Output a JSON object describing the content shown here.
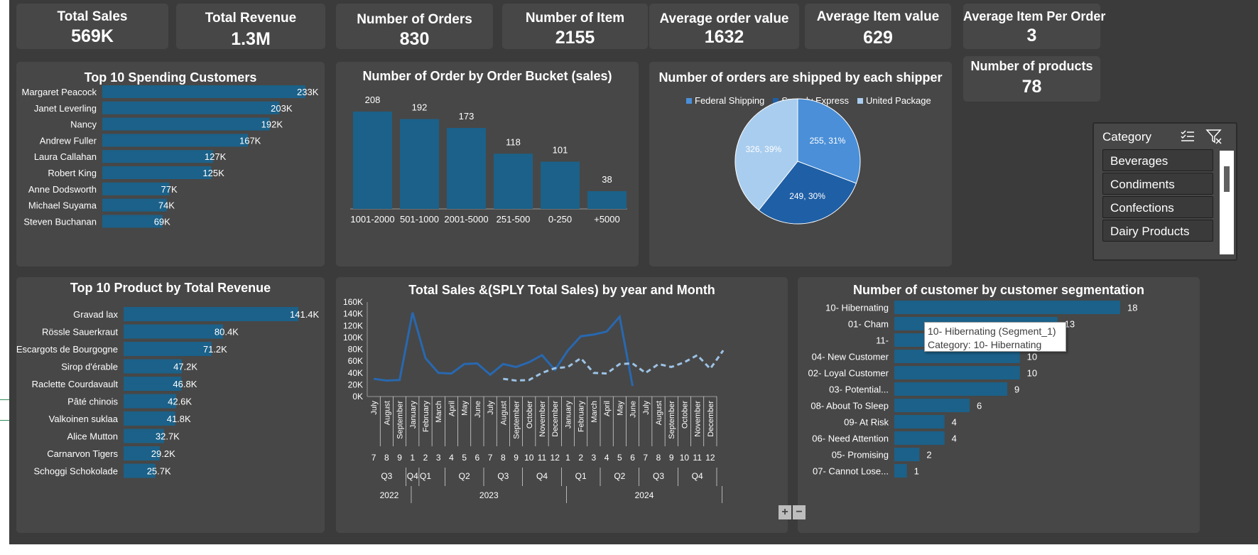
{
  "kpis": [
    {
      "label": "Total Sales",
      "value": "569K"
    },
    {
      "label": "Total Revenue",
      "value": "1.3M"
    },
    {
      "label": "Number of Orders",
      "value": "830"
    },
    {
      "label": "Number of Item",
      "value": "2155"
    },
    {
      "label": "Average order value",
      "value": "1632"
    },
    {
      "label": "Average Item value",
      "value": "629"
    },
    {
      "label": "Average Item Per Order",
      "value": "3"
    },
    {
      "label": "Number of products",
      "value": "78"
    }
  ],
  "slicer": {
    "header": "Category",
    "items": [
      "Beverages",
      "Condiments",
      "Confections",
      "Dairy Products"
    ],
    "icons": [
      "multi-select-icon",
      "clear-filter-icon"
    ]
  },
  "tooltip": {
    "line1": "10- Hibernating (Segment_1)",
    "line2": "Category: 10- Hibernating"
  },
  "zoom": {
    "plus": "+",
    "minus": "−"
  },
  "colors": {
    "background": "#3b3b3b",
    "card": "#474747",
    "bar": "#1b6189",
    "line_current": "#2868b0",
    "line_sply": "#9dc3e6",
    "pie_federal": "#4a8fd8",
    "pie_speedy": "#1f5fa6",
    "pie_united": "#a9cdee"
  },
  "chart_data": [
    {
      "id": "top_customers",
      "type": "bar",
      "orientation": "horizontal",
      "title": "Top 10 Spending Customers",
      "categories": [
        "Margaret Peacock",
        "Janet Leverling",
        "Nancy",
        "Andrew Fuller",
        "Laura Callahan",
        "Robert King",
        "Anne Dodsworth",
        "Michael Suyama",
        "Steven Buchanan"
      ],
      "values": [
        233,
        203,
        192,
        167,
        127,
        125,
        77,
        74,
        69
      ],
      "labels": [
        "233K",
        "203K",
        "192K",
        "167K",
        "127K",
        "125K",
        "77K",
        "74K",
        "69K"
      ]
    },
    {
      "id": "order_bucket",
      "type": "bar",
      "title": "Number of Order  by  Order Bucket  (sales)",
      "categories": [
        "1001-2000",
        "501-1000",
        "2001-5000",
        "251-500",
        "0-250",
        "+5000"
      ],
      "values": [
        208,
        192,
        173,
        118,
        101,
        38
      ]
    },
    {
      "id": "shippers",
      "type": "pie",
      "title": "Number of orders are shipped by each shipper",
      "legend_position": "top",
      "categories": [
        "Federal Shipping",
        "Speedy Express",
        "United Package"
      ],
      "values": [
        255,
        249,
        326
      ],
      "labels": [
        "255, 31%",
        "249, 30%",
        "326, 39%"
      ]
    },
    {
      "id": "top_products",
      "type": "bar",
      "orientation": "horizontal",
      "title": "Top 10 Product by Total Revenue",
      "categories": [
        "Gravad lax",
        "Rössle Sauerkraut",
        "Escargots de Bourgogne",
        "Sirop d'érable",
        "Raclette Courdavault",
        "Pâté chinois",
        "Valkoinen suklaa",
        "Alice Mutton",
        "Carnarvon Tigers",
        "Schoggi Schokolade"
      ],
      "values": [
        141.4,
        80.4,
        71.2,
        47.2,
        46.8,
        42.6,
        41.8,
        32.7,
        29.2,
        25.7
      ],
      "labels": [
        "141.4K",
        "80.4K",
        "71.2K",
        "47.2K",
        "46.8K",
        "42.6K",
        "41.8K",
        "32.7K",
        "29.2K",
        "25.7K"
      ]
    },
    {
      "id": "sales_trend",
      "type": "line",
      "title": "Total Sales &(SPLY Total Sales) by year and Month",
      "ylim": [
        0,
        160
      ],
      "yticks": [
        "0K",
        "20K",
        "40K",
        "60K",
        "80K",
        "100K",
        "120K",
        "140K",
        "160K"
      ],
      "months": [
        "July",
        "August",
        "September",
        "January",
        "February",
        "March",
        "April",
        "May",
        "June",
        "July",
        "August",
        "September",
        "October",
        "November",
        "December",
        "January",
        "February",
        "March",
        "April",
        "May",
        "June",
        "July",
        "August",
        "September",
        "October",
        "November",
        "December"
      ],
      "month_numbers": [
        "7",
        "8",
        "9",
        "1",
        "2",
        "3",
        "4",
        "5",
        "6",
        "7",
        "8",
        "9",
        "10",
        "11",
        "12",
        "1",
        "2",
        "3",
        "4",
        "5",
        "6",
        "7",
        "8",
        "9",
        "10",
        "11",
        "12"
      ],
      "quarters": [
        {
          "label": "Q3",
          "span": 3
        },
        {
          "label": "Q4",
          "span": 0
        },
        {
          "label": "Q1",
          "span": 3
        },
        {
          "label": "Q2",
          "span": 3
        },
        {
          "label": "Q3",
          "span": 3
        },
        {
          "label": "Q4",
          "span": 3
        },
        {
          "label": "Q1",
          "span": 3
        },
        {
          "label": "Q2",
          "span": 3
        },
        {
          "label": "Q3",
          "span": 3
        },
        {
          "label": "Q4",
          "span": 3
        }
      ],
      "years": [
        {
          "label": "2022",
          "span": 4
        },
        {
          "label": "2023",
          "span": 12
        },
        {
          "label": "2024",
          "span": 12
        }
      ],
      "series": [
        {
          "values": [
            30,
            27,
            28,
            142,
            65,
            40,
            39,
            55,
            56,
            37,
            55,
            50,
            58,
            70,
            45,
            78,
            102,
            105,
            110,
            135,
            18,
            null,
            null,
            null,
            null,
            null,
            null,
            null
          ]
        },
        {
          "values": [
            null,
            null,
            null,
            null,
            null,
            null,
            null,
            null,
            null,
            null,
            30,
            27,
            28,
            40,
            48,
            50,
            65,
            40,
            39,
            55,
            56,
            40,
            55,
            50,
            58,
            70,
            47,
            78
          ]
        }
      ]
    },
    {
      "id": "segments",
      "type": "bar",
      "orientation": "horizontal",
      "title": "Number of customer by customer segmentation",
      "categories": [
        "10- Hibernating",
        "01- Champions",
        "11- Lost",
        "04- New Customer",
        "02- Loyal Customer",
        "03- Potential...",
        "08- About To Sleep",
        "09- At Risk",
        "06- Need Attention",
        "05- Promising",
        "07- Cannot Lose..."
      ],
      "visible_categories": [
        "10- Hibernating",
        "01- Cham",
        "11-",
        "04- New Customer",
        "02- Loyal Customer",
        "03- Potential...",
        "08- About To Sleep",
        "09- At Risk",
        "06- Need Attention",
        "05- Promising",
        "07- Cannot Lose..."
      ],
      "values": [
        18,
        13,
        12,
        10,
        10,
        9,
        6,
        4,
        4,
        2,
        1
      ]
    }
  ]
}
